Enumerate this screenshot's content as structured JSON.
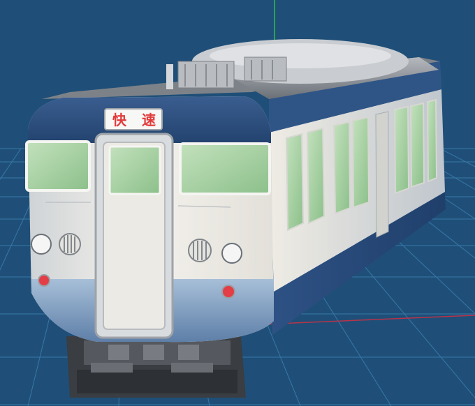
{
  "scene": {
    "destination_sign": {
      "char_1": "快",
      "char_2": "速"
    }
  },
  "colors": {
    "background": "#1f4f78",
    "grid_line": "#3f86b8",
    "axis_red": "#b8334a",
    "axis_green": "#2fbf4f",
    "body_cream": "#e9e7e0",
    "body_blue": "#2c4f80",
    "roof_grey": "#8a8f96",
    "window_green": "#a9d3a3",
    "bogie_dark": "#3a3d42",
    "headlight": "#f5f5f5",
    "tail_light": "#e33d46",
    "sign_text": "#e23a3a"
  },
  "icons": {
    "left_headlight": "headlight-icon",
    "right_headlight": "headlight-icon",
    "left_taillight": "taillight-icon",
    "right_taillight": "taillight-icon",
    "left_horn_vent": "horn-vent-icon",
    "right_horn_vent": "horn-vent-icon"
  }
}
